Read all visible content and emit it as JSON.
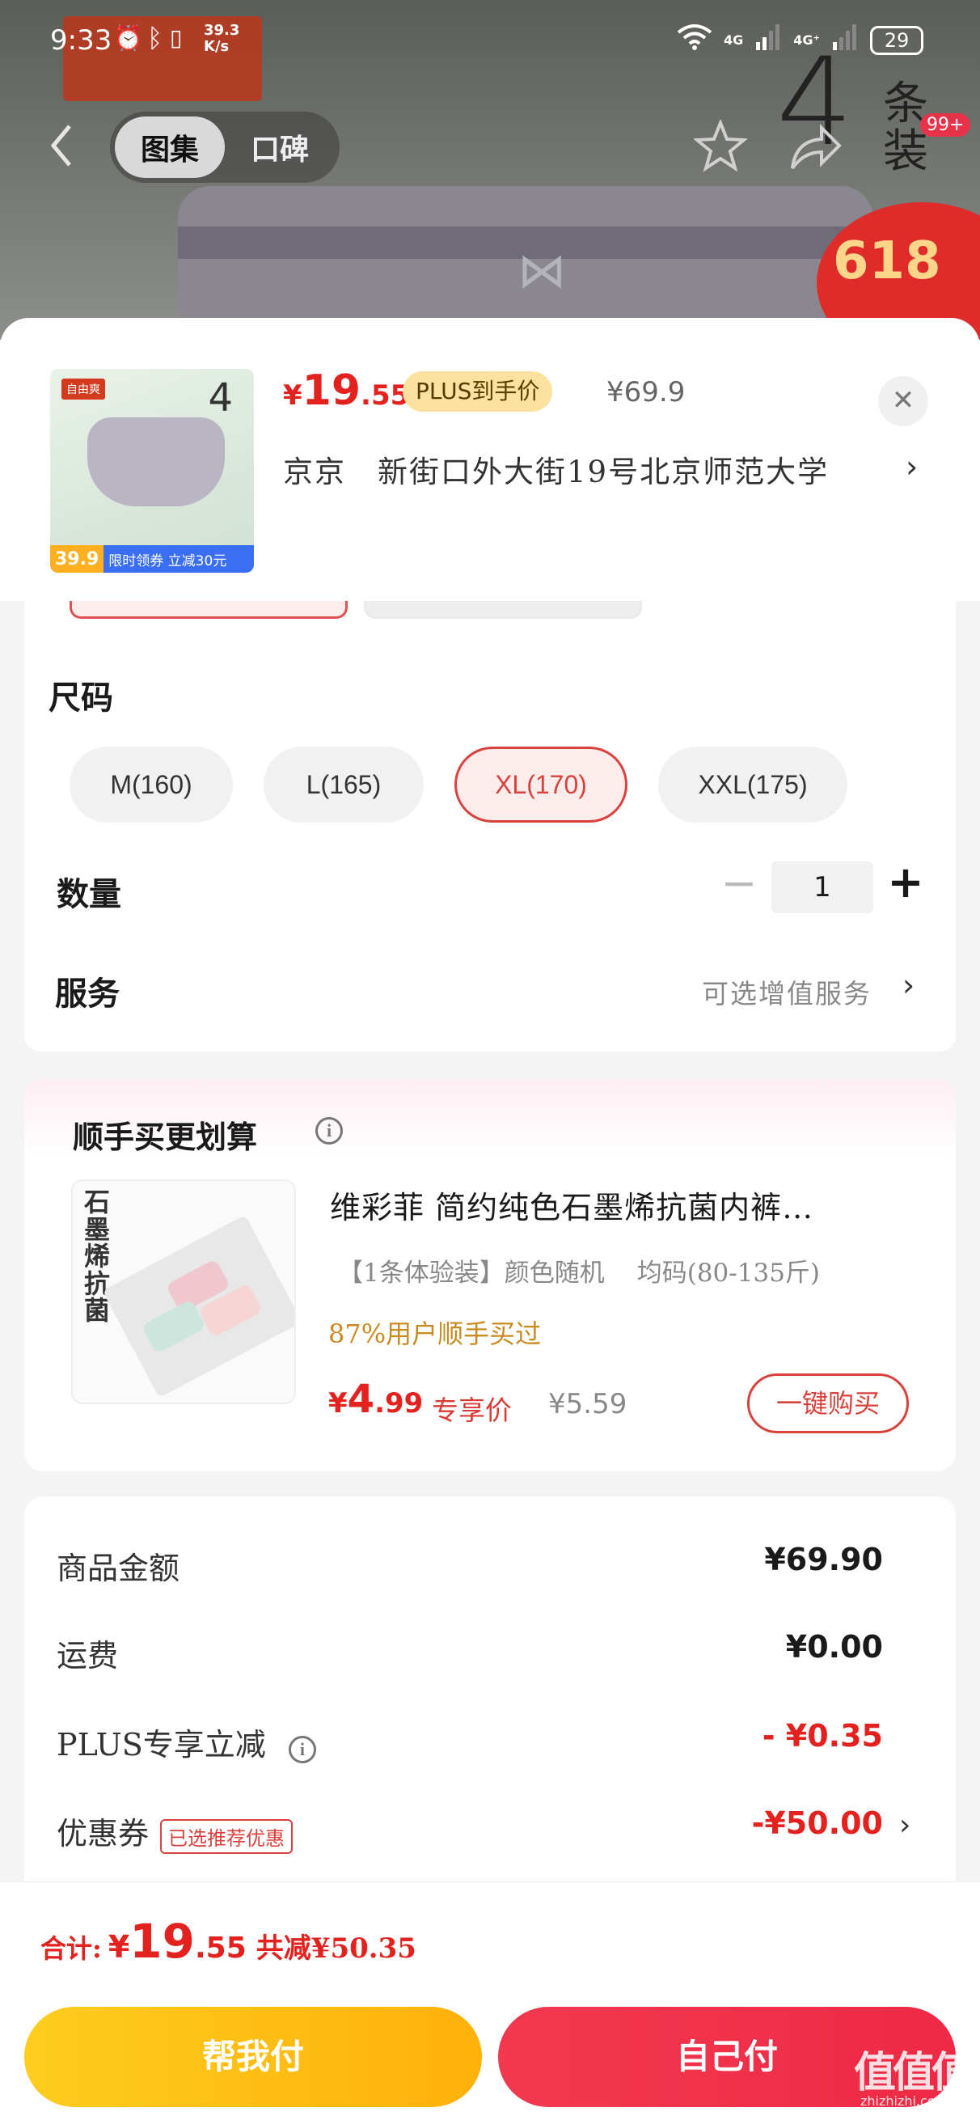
{
  "status_bar": {
    "time": "9:33",
    "net_speed": "39.3",
    "net_unit": "K/s",
    "net_type_1": "4G",
    "net_type_2": "4G⁺",
    "battery": "29"
  },
  "gallery": {
    "tabs": [
      {
        "label": "图集",
        "active": true
      },
      {
        "label": "口碑",
        "active": false
      }
    ],
    "photo_text": {
      "count": "4",
      "unit_1": "条",
      "unit_2": "装",
      "badge": "99+",
      "promo": "618"
    }
  },
  "product": {
    "thumb": {
      "brand": "自由爽",
      "count": "4",
      "tag_price": "39.9",
      "tag_promo": "限时领券 立减30元"
    },
    "price_symbol": "¥",
    "price_int": "19",
    "price_dec": ".55",
    "plus_label": "PLUS到手价",
    "original_price": "¥69.9",
    "address": "京京　新街口外大街19号北京师范大学"
  },
  "size": {
    "title": "尺码",
    "options": [
      {
        "label": "M(160)",
        "selected": false
      },
      {
        "label": "L(165)",
        "selected": false
      },
      {
        "label": "XL(170)",
        "selected": true
      },
      {
        "label": "XXL(175)",
        "selected": false
      }
    ]
  },
  "quantity": {
    "label": "数量",
    "value": "1",
    "minus": "−",
    "plus": "+"
  },
  "service": {
    "label": "服务",
    "value": "可选增值服务"
  },
  "bundle": {
    "title": "顺手买更划算",
    "img_text": "石墨烯抗菌",
    "name": "维彩菲  简约纯色石墨烯抗菌内裤…",
    "spec": "【1条体验装】颜色随机",
    "spec_size": "均码(80-135斤)",
    "rate": "87%用户顺手买过",
    "price_symbol": "¥",
    "price_int": "4",
    "price_dec": ".99",
    "exclusive": "专享价",
    "original_price": "¥5.59",
    "buy_label": "一键购买"
  },
  "summary": {
    "rows": [
      {
        "label": "商品金额",
        "value": "¥69.90"
      },
      {
        "label": "运费",
        "value": "¥0.00"
      },
      {
        "label": "PLUS专享立减",
        "value": "- ¥0.35"
      },
      {
        "label": "优惠券",
        "value": "-¥50.00",
        "tag": "已选推荐优惠"
      }
    ]
  },
  "footer": {
    "total_label": "合计:",
    "total_symbol": "¥",
    "total_int": "19",
    "total_dec": ".55",
    "saved": "共减¥50.35",
    "help_pay": "帮我付",
    "self_pay": "自己付"
  },
  "watermark": {
    "logo": "值值值",
    "domain": "zhizhizhi.com"
  },
  "colors": {
    "price_red": "#e3211e",
    "plus_tag_bg": "#fbe2a0",
    "help_btn": "#ffbe14",
    "self_btn": "#f0304a"
  }
}
